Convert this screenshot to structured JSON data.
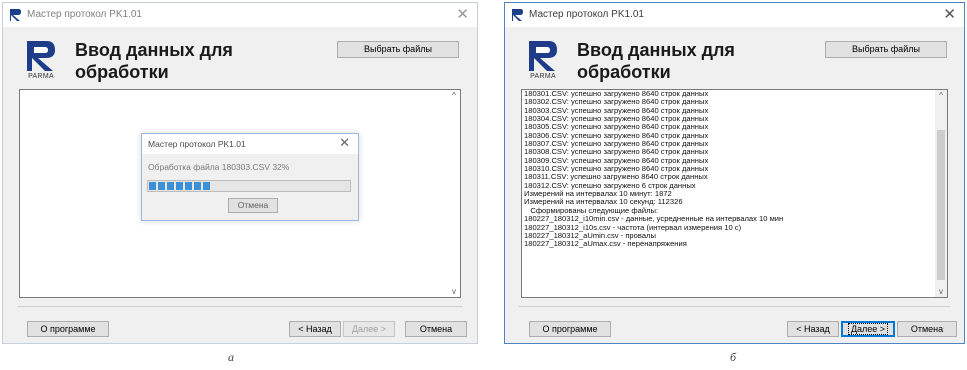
{
  "window_a": {
    "title": "Мастер протокол PK1.01",
    "heading_line1": "Ввод данных для",
    "heading_line2": "обработки",
    "logo_text": "PARMA",
    "select_files_label": "Выбрать файлы",
    "about_label": "О программе",
    "back_label": "< Назад",
    "next_label": "Далее >",
    "cancel_label": "Отмена",
    "dialog": {
      "title": "Мастер протокол PK1.01",
      "status_text": "Обработка файла 180303.CSV  32%",
      "progress": 0.32,
      "cancel_label": "Отмена"
    },
    "caption": "а"
  },
  "window_b": {
    "title": "Мастер протокол PK1.01",
    "heading_line1": "Ввод данных для",
    "heading_line2": "обработки",
    "logo_text": "PARMA",
    "select_files_label": "Выбрать файлы",
    "about_label": "О программе",
    "back_label": "< Назад",
    "next_label": "Далее >",
    "cancel_label": "Отмена",
    "log_lines": [
      "180301.CSV: успешно загружено 8640 строк данных",
      "180302.CSV: успешно загружено 8640 строк данных",
      "180303.CSV: успешно загружено 8640 строк данных",
      "180304.CSV: успешно загружено 8640 строк данных",
      "180305.CSV: успешно загружено 8640 строк данных",
      "180306.CSV: успешно загружено 8640 строк данных",
      "180307.CSV: успешно загружено 8640 строк данных",
      "180308.CSV: успешно загружено 8640 строк данных",
      "180309.CSV: успешно загружено 8640 строк данных",
      "180310.CSV: успешно загружено 8640 строк данных",
      "180311.CSV: успешно загружено 8640 строк данных",
      "180312.CSV: успешно загружено 6 строк данных",
      "Измерений на интервалах 10 минут: 1872",
      "Измерений на интервалах 10 секунд: 112326",
      "   Сформированы следующие файлы:",
      "180227_180312_i10min.csv - данные, усредненные на интервалах 10 мин",
      "180227_180312_i10s.csv - частота (интервал измерения 10 с)",
      "180227_180312_aUmin.csv - провалы",
      "180227_180312_aUmax.csv - перенапряжения"
    ],
    "caption": "б"
  },
  "colors": {
    "progress_fill": "#3b8ed8",
    "active_border": "#4f84c7",
    "default_button_border": "#0078d7"
  },
  "icons": [
    "parma-logo-icon",
    "app-icon",
    "close-icon",
    "scroll-up-icon",
    "scroll-down-icon"
  ]
}
